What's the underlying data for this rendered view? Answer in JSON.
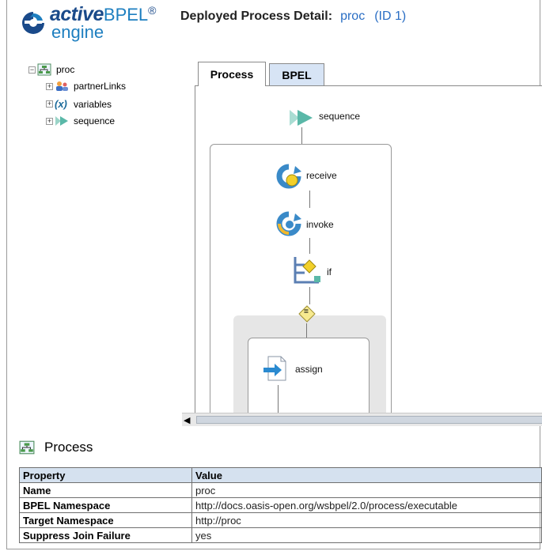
{
  "header": {
    "logo": {
      "active": "active",
      "bpel": "BPEL",
      "reg": "®",
      "engine": "engine"
    },
    "title": "Deployed Process Detail:",
    "process_name": "proc",
    "process_id": "(ID 1)"
  },
  "tree": {
    "root": "proc",
    "children": [
      "partnerLinks",
      "variables",
      "sequence"
    ]
  },
  "tabs": [
    {
      "label": "Process",
      "active": true
    },
    {
      "label": "BPEL",
      "active": false
    }
  ],
  "diagram": {
    "activities": [
      "sequence",
      "receive",
      "invoke",
      "if",
      "assign"
    ],
    "condition_symbol": "="
  },
  "section": {
    "title": "Process"
  },
  "properties": {
    "headers": [
      "Property",
      "Value"
    ],
    "rows": [
      {
        "key": "Name",
        "value": "proc"
      },
      {
        "key": "BPEL Namespace",
        "value": "http://docs.oasis-open.org/wsbpel/2.0/process/executable"
      },
      {
        "key": "Target Namespace",
        "value": "http://proc"
      },
      {
        "key": "Suppress Join Failure",
        "value": "yes"
      }
    ]
  },
  "colors": {
    "accent": "#2a6ec4",
    "brand": "#1a4a8a",
    "tab_inactive": "#d7e4f5",
    "table_header": "#d5e1ef"
  }
}
